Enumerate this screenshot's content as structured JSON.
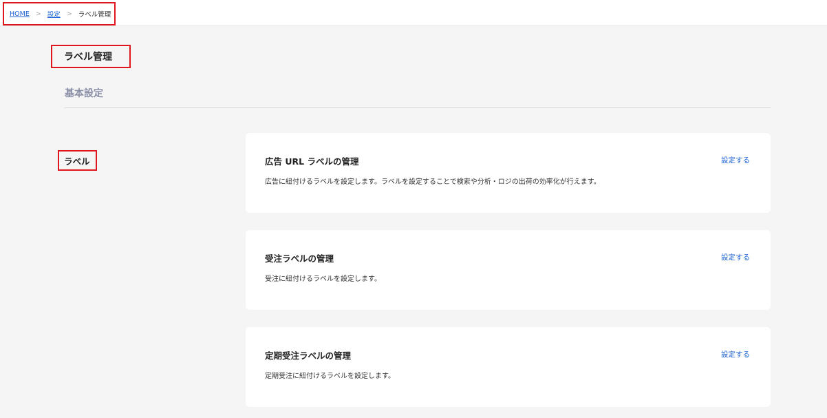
{
  "breadcrumb": {
    "home": "HOME",
    "settings": "設定",
    "current": "ラベル管理",
    "separator": ">"
  },
  "page_title": "ラベル管理",
  "section_title": "基本設定",
  "side_label": "ラベル",
  "cards": [
    {
      "title": "広告 URL ラベルの管理",
      "description": "広告に紐付けるラベルを設定します。ラベルを設定することで検索や分析・ロジの出荷の効率化が行えます。",
      "link": "設定する"
    },
    {
      "title": "受注ラベルの管理",
      "description": "受注に紐付けるラベルを設定します。",
      "link": "設定する"
    },
    {
      "title": "定期受注ラベルの管理",
      "description": "定期受注に紐付けるラベルを設定します。",
      "link": "設定する"
    }
  ],
  "colors": {
    "link": "#1e63d4",
    "highlight_border": "#e0161e",
    "section_title": "#8a8fa6",
    "background": "#f5f5f6"
  }
}
